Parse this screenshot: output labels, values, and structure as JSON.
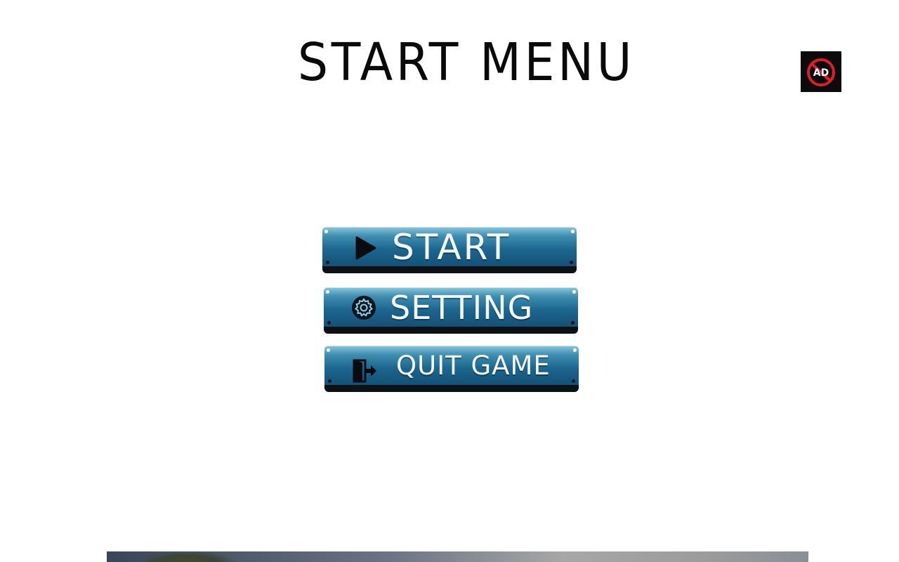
{
  "screen": {
    "title": "START MENU"
  },
  "ad_button": {
    "label": "AD",
    "icon": "no-ads-icon"
  },
  "menu": {
    "items": [
      {
        "label": "START",
        "icon": "play-icon"
      },
      {
        "label": "SETTING",
        "icon": "gear-icon"
      },
      {
        "label": "QUIT GAME",
        "icon": "exit-door-icon"
      }
    ]
  },
  "colors": {
    "background": "#ffffff",
    "button_top": "#8dc6dc",
    "button_mid": "#1c6690",
    "button_bottom": "#144f74",
    "button_base": "#0b1115",
    "button_text": "#f4f8fa",
    "no_ad_red": "#e01e2b"
  }
}
